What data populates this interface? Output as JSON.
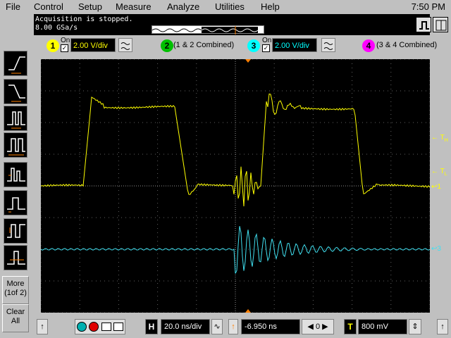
{
  "menu": {
    "items": [
      "File",
      "Control",
      "Setup",
      "Measure",
      "Analyze",
      "Utilities",
      "Help"
    ],
    "clock": "7:50 PM"
  },
  "status": {
    "line1": "Acquisition is stopped.",
    "line2": "8.00 GSa/s"
  },
  "channels": [
    {
      "num": "1",
      "on_label": "On",
      "scale": "2.00 V/div",
      "color": "#ffff00"
    },
    {
      "num": "2",
      "label": "(1 & 2 Combined)",
      "color": "#00c000"
    },
    {
      "num": "3",
      "on_label": "On",
      "scale": "2.00 V/div",
      "color": "#00ffff"
    },
    {
      "num": "4",
      "label": "(3 & 4 Combined)",
      "color": "#ff00ff"
    }
  ],
  "left_toolbar": {
    "more_label": "More (1of 2)",
    "clear_label": "Clear All",
    "icons": [
      "edge-rising-icon",
      "edge-falling-icon",
      "glitch-icon",
      "pulse-width-icon",
      "runt-icon",
      "pattern-icon",
      "state-icon",
      "timeout-icon"
    ]
  },
  "markers": {
    "tw": "← T",
    "tw_sub": "H",
    "tl": "← T",
    "tl_sub": "L",
    "ch1": "1",
    "ch3": "3"
  },
  "bottom": {
    "h_label": "H",
    "timebase": "20.0 ns/div",
    "delay": "-6.950 ns",
    "trig_label": "T",
    "trig_level": "800 mV"
  },
  "colors": {
    "ch1": "#ffff00",
    "ch3": "#40e0f0",
    "grid": "#606060",
    "trigger_marker": "#ff8000"
  }
}
